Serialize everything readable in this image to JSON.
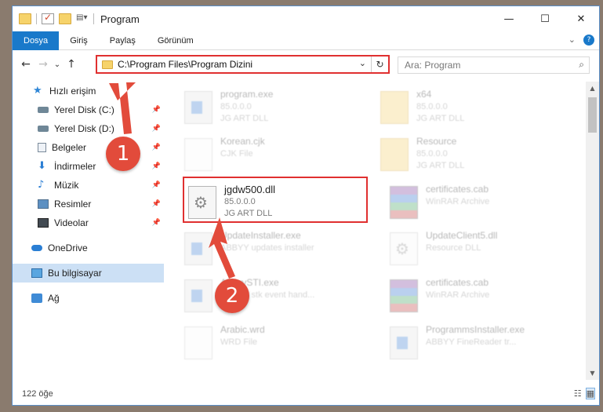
{
  "window": {
    "title": "Program"
  },
  "titlebar_controls": {
    "minimize": "—",
    "maximize": "☐",
    "close": "✕"
  },
  "ribbon": {
    "tabs": [
      {
        "label": "Dosya",
        "active": true
      },
      {
        "label": "Giriş"
      },
      {
        "label": "Paylaş"
      },
      {
        "label": "Görünüm"
      }
    ],
    "expand_glyph": "⌄",
    "help_glyph": "?"
  },
  "nav": {
    "back": "←",
    "forward": "→",
    "recent": "⌄",
    "up": "↑",
    "address": "C:\\Program Files\\Program Dizini",
    "address_dropdown": "⌄",
    "refresh": "↻",
    "search_placeholder": "Ara: Program",
    "search_icon": "⌕"
  },
  "sidebar": {
    "items": [
      {
        "label": "Hızlı erişim",
        "icon": "star-icon",
        "pinned": false
      },
      {
        "label": "Yerel Disk (C:)",
        "icon": "drive-icon",
        "pinned": true
      },
      {
        "label": "Yerel Disk (D:)",
        "icon": "drive-icon",
        "pinned": true
      },
      {
        "label": "Belgeler",
        "icon": "document-icon",
        "pinned": true
      },
      {
        "label": "İndirmeler",
        "icon": "download-icon",
        "pinned": true
      },
      {
        "label": "Müzik",
        "icon": "music-icon",
        "pinned": true
      },
      {
        "label": "Resimler",
        "icon": "pictures-icon",
        "pinned": true
      },
      {
        "label": "Videolar",
        "icon": "videos-icon",
        "pinned": true
      },
      {
        "label": "OneDrive",
        "icon": "cloud-icon"
      },
      {
        "label": "Bu bilgisayar",
        "icon": "computer-icon",
        "selected": true
      },
      {
        "label": "Ağ",
        "icon": "network-icon"
      }
    ],
    "pin_glyph": "📌"
  },
  "files": [
    {
      "name": "program.exe",
      "line1": "85.0.0.0",
      "line2": "JG ART DLL",
      "icon": "exe-icon",
      "faded": true
    },
    {
      "name": "x64",
      "line1": "85.0.0.0",
      "line2": "JG ART DLL",
      "icon": "folder-icon",
      "faded": true
    },
    {
      "name": "Korean.cjk",
      "line1": "CJK File",
      "line2": "",
      "icon": "blank-file-icon",
      "faded": true
    },
    {
      "name": "Resource",
      "line1": "85.0.0.0",
      "line2": "JG ART DLL",
      "icon": "folder-icon",
      "faded": true
    },
    {
      "name": "jgdw500.dll",
      "line1": "85.0.0.0",
      "line2": "JG ART DLL",
      "icon": "dll-gear-icon",
      "faded": false
    },
    {
      "name": "certificates.cab",
      "line1": "WinRAR Archive",
      "line2": "",
      "icon": "winrar-icon",
      "faded": true
    },
    {
      "name": "UpdateInstaller.exe",
      "line1": "ABBYY updates installer",
      "line2": "",
      "icon": "exe-icon",
      "faded": true
    },
    {
      "name": "UpdateClient5.dll",
      "line1": "Resource DLL",
      "line2": "",
      "icon": "dll-gear-icon",
      "faded": true
    },
    {
      "name": "AbbyySTI.exe",
      "line1": "ABBYY stk event hand...",
      "line2": "",
      "icon": "exe-icon",
      "faded": true
    },
    {
      "name": "certificates.cab",
      "line1": "WinRAR Archive",
      "line2": "",
      "icon": "winrar-icon",
      "faded": true
    },
    {
      "name": "Arabic.wrd",
      "line1": "WRD File",
      "line2": "",
      "icon": "blank-file-icon",
      "faded": true
    },
    {
      "name": "ProgrammsInstaller.exe",
      "line1": "ABBYY FineReader tr...",
      "line2": "",
      "icon": "exe-icon",
      "faded": true
    }
  ],
  "status": {
    "item_count": "122 öğe",
    "details_view": "☷",
    "tiles_view": "▦"
  },
  "annotations": {
    "badge1": "1",
    "badge2": "2",
    "accent_color": "#e24b3b"
  },
  "colors": {
    "ribbon_active": "#1979ca",
    "highlight": "#e03030",
    "selected_bg": "#cce0f5"
  }
}
